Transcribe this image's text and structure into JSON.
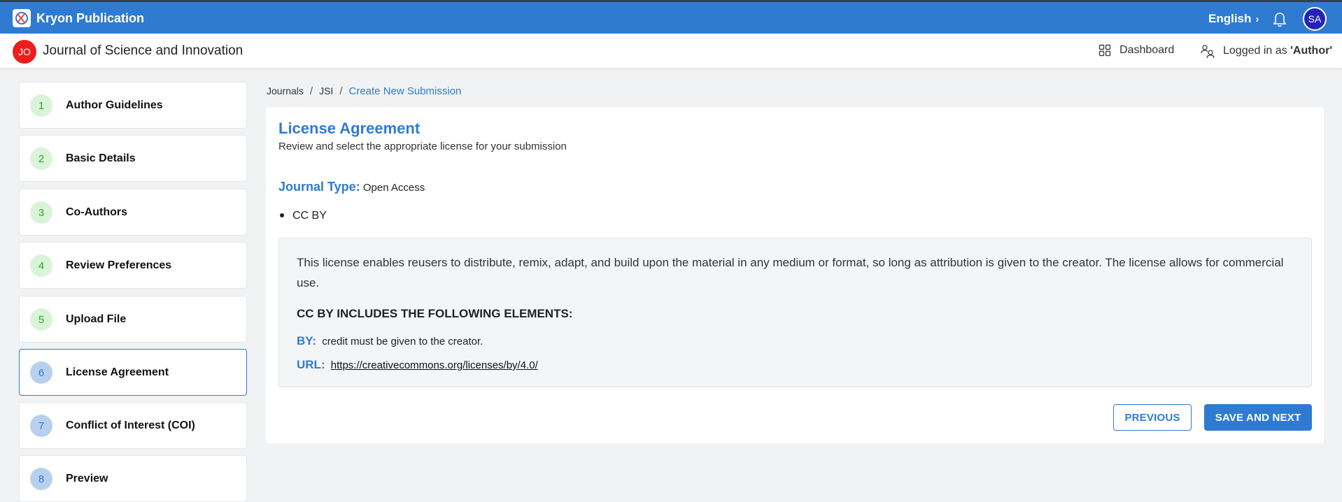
{
  "app": {
    "name": "Kryon Publication",
    "language": "English",
    "avatar_initials": "SA"
  },
  "journal": {
    "badge": "JO",
    "title": "Journal of Science and Innovation"
  },
  "subnav": {
    "dashboard": "Dashboard",
    "logged_prefix": "Logged in as ",
    "role": "'Author'"
  },
  "steps": [
    {
      "num": "1",
      "label": "Author Guidelines",
      "state": "done"
    },
    {
      "num": "2",
      "label": "Basic Details",
      "state": "done"
    },
    {
      "num": "3",
      "label": "Co-Authors",
      "state": "done"
    },
    {
      "num": "4",
      "label": "Review Preferences",
      "state": "done"
    },
    {
      "num": "5",
      "label": "Upload File",
      "state": "done"
    },
    {
      "num": "6",
      "label": "License Agreement",
      "state": "active"
    },
    {
      "num": "7",
      "label": "Conflict of Interest (COI)",
      "state": "todo"
    },
    {
      "num": "8",
      "label": "Preview",
      "state": "todo"
    }
  ],
  "breadcrumb": {
    "items": [
      "Journals",
      "JSI"
    ],
    "current": "Create New Submission"
  },
  "license": {
    "title": "License Agreement",
    "subtitle": "Review and select the appropriate license for your submission",
    "journal_type_label": "Journal Type:",
    "journal_type_value": "Open Access",
    "selected_license": "CC BY",
    "description": "This license enables reusers to distribute, remix, adapt, and build upon the material in any medium or format, so long as attribution is given to the creator. The license allows for commercial use.",
    "includes_heading": "CC BY INCLUDES THE FOLLOWING ELEMENTS:",
    "by_label": "BY:",
    "by_text": "credit must be given to the creator.",
    "url_label": "URL:",
    "url": "https://creativecommons.org/licenses/by/4.0/"
  },
  "buttons": {
    "previous": "PREVIOUS",
    "save_next": "SAVE AND NEXT"
  },
  "colors": {
    "primary": "#2f7bd2",
    "journal_badge": "#ec1d1d",
    "avatar": "#2523b7",
    "done_step": "#d9f4d9",
    "todo_step": "#b7d0ee"
  }
}
